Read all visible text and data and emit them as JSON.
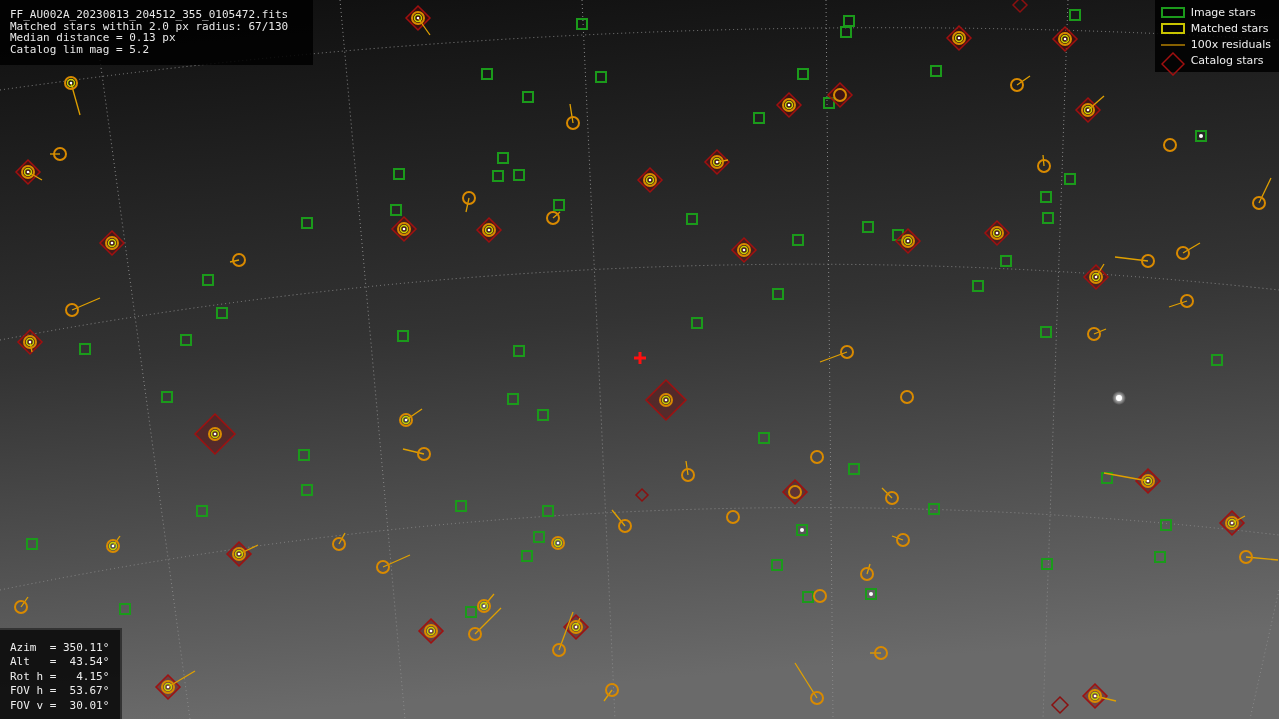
{
  "file_info": {
    "lines": [
      "FF_AU002A_20230813_204512_355_0105472.fits",
      "Matched stars within 2.0 px radius: 67/130",
      "Median distance = 0.13 px",
      "Catalog lim mag = 5.2"
    ]
  },
  "legend": {
    "items": [
      {
        "kind": "image",
        "label": "Image stars"
      },
      {
        "kind": "matched",
        "label": "Matched stars"
      },
      {
        "kind": "residual",
        "label": "100x residuals"
      },
      {
        "kind": "catalog",
        "label": "Catalog stars"
      }
    ]
  },
  "pointing": {
    "lines": [
      "Azim  = 350.11°",
      "Alt   =  43.54°",
      "Rot h =   4.15°",
      "FOV h =  53.67°",
      "FOV v =  30.01°"
    ]
  }
}
